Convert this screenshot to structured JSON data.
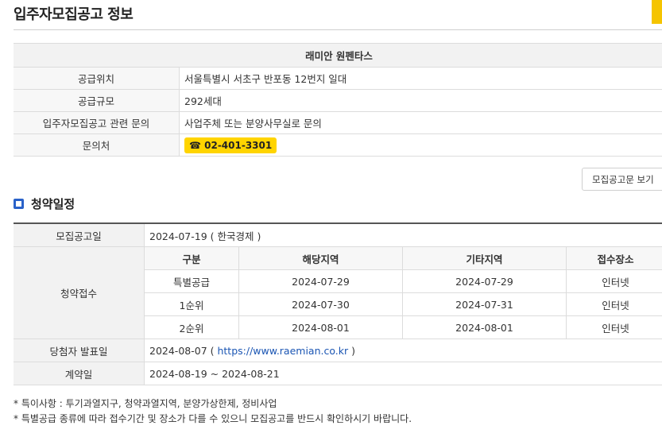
{
  "page": {
    "title": "입주자모집공고 정보"
  },
  "info": {
    "complex_name": "래미안 원펜타스",
    "rows": [
      {
        "label": "공급위치",
        "value": "서울특별시 서초구 반포동 12번지 일대"
      },
      {
        "label": "공급규모",
        "value": "292세대"
      },
      {
        "label": "입주자모집공고 관련 문의",
        "value": "사업주체 또는 분양사무실로 문의"
      }
    ],
    "contact_label": "문의처",
    "phone": "☎ 02-401-3301"
  },
  "notice_button": "모집공고문 보기",
  "schedule": {
    "title": "청약일정",
    "announce_label": "모집공고일",
    "announce_value": "2024-07-19 ( 한국경제 )",
    "reception_label": "청약접수",
    "columns": [
      "구분",
      "해당지역",
      "기타지역",
      "접수장소"
    ],
    "rows": [
      [
        "특별공급",
        "2024-07-29",
        "2024-07-29",
        "인터넷"
      ],
      [
        "1순위",
        "2024-07-30",
        "2024-07-31",
        "인터넷"
      ],
      [
        "2순위",
        "2024-08-01",
        "2024-08-01",
        "인터넷"
      ]
    ],
    "winner_label": "당첨자 발표일",
    "winner_date": "2024-08-07",
    "winner_open": " ( ",
    "winner_link": "https://www.raemian.co.kr",
    "winner_close": " )",
    "contract_label": "계약일",
    "contract_value": "2024-08-19 ~ 2024-08-21"
  },
  "notes": [
    "* 특이사항 : 투기과열지구, 청약과열지역, 분양가상한제, 정비사업",
    "* 특별공급 종류에 따라 접수기간 및 장소가 다를 수 있으니 모집공고를 반드시 확인하시기 바랍니다."
  ],
  "colors": {
    "accent": "#2a62c9",
    "phone_bg": "#ffd400",
    "link": "#1a55b3"
  }
}
